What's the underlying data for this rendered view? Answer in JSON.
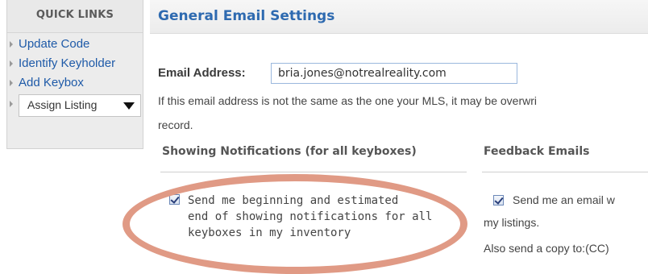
{
  "quick_links": {
    "title": "QUICK LINKS",
    "items": [
      {
        "label": "Update Code"
      },
      {
        "label": "Identify Keyholder"
      },
      {
        "label": "Add Keybox"
      }
    ],
    "assign_select": {
      "value": "Assign Listing"
    }
  },
  "main": {
    "title": "General Email Settings",
    "email": {
      "label": "Email Address:",
      "value": "bria.jones@notrealreality.com"
    },
    "info_line1": "If this email address is not the same as the one your MLS, it may be overwri",
    "info_line2": "record."
  },
  "showing_notifications": {
    "heading": "Showing Notifications (for all keyboxes)",
    "checkbox_checked": true,
    "text_lines": [
      "Send me beginning and estimated",
      "end of showing notifications for all",
      "keyboxes in my inventory"
    ]
  },
  "feedback": {
    "heading": "Feedback Emails",
    "checkbox_checked": true,
    "line1": "Send me an email w",
    "line2": "my listings.",
    "cc_label": "Also send a copy to:(CC)"
  },
  "colors": {
    "link": "#1e5aa8",
    "title": "#2e6ab0",
    "annotation": "#e09a85"
  },
  "icons": {
    "ql_bullet": "caret-right-icon",
    "select_arrow": "triangle-down-icon",
    "checkbox": "checkmark-icon"
  }
}
